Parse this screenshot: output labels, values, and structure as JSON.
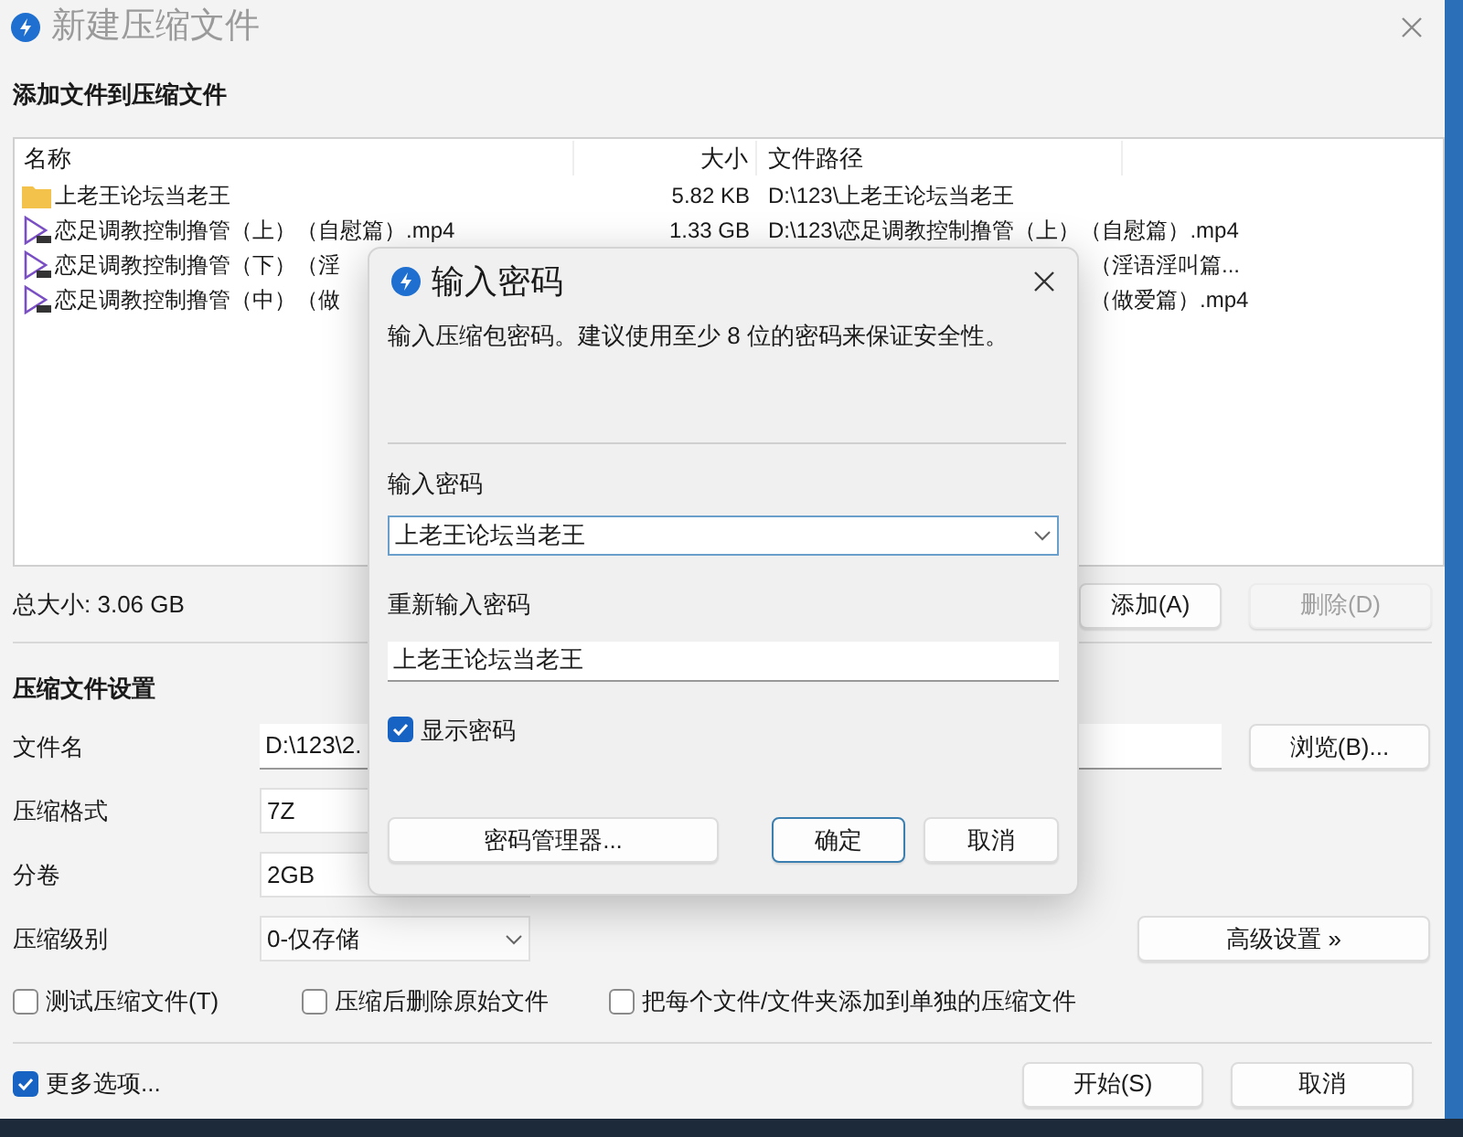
{
  "window": {
    "title": "新建压缩文件"
  },
  "files": {
    "heading": "添加文件到压缩文件",
    "columns": [
      "名称",
      "大小",
      "文件路径"
    ],
    "rows": [
      {
        "kind": "folder",
        "name": "上老王论坛当老王",
        "size": "5.82 KB",
        "path": "D:\\123\\上老王论坛当老王"
      },
      {
        "kind": "video",
        "name": "恋足调教控制撸管（上）（自慰篇）.mp4",
        "size": "1.33 GB",
        "path": "D:\\123\\恋足调教控制撸管（上）（自慰篇）.mp4"
      },
      {
        "kind": "video",
        "name": "恋足调教控制撸管（下）（淫",
        "path_tail": "（淫语淫叫篇..."
      },
      {
        "kind": "video",
        "name": "恋足调教控制撸管（中）（做",
        "path_tail": "（做爱篇）.mp4"
      }
    ],
    "total_size": "总大小: 3.06 GB",
    "buttons": [
      {
        "label": "添加(A)",
        "disabled": false
      },
      {
        "label": "删除(D)",
        "disabled": true
      }
    ]
  },
  "settings": {
    "heading": "压缩文件设置",
    "filename": {
      "label": "文件名",
      "value": "D:\\123\\2.",
      "button": "浏览(B)..."
    },
    "format": {
      "label": "压缩格式",
      "value": "7Z"
    },
    "split": {
      "label": "分卷",
      "value": "2GB"
    },
    "level": {
      "label": "压缩级别",
      "value": "0-仅存储",
      "button": "高级设置 »"
    },
    "options": [
      {
        "label": "测试压缩文件(T)",
        "checked": false
      },
      {
        "label": "压缩后删除原始文件",
        "checked": false
      },
      {
        "label": "把每个文件/文件夹添加到单独的压缩文件",
        "checked": false
      }
    ]
  },
  "footer": {
    "more_options": {
      "label": "更多选项...",
      "checked": true
    },
    "buttons": [
      "开始(S)",
      "取消"
    ]
  },
  "dialog": {
    "title": "输入密码",
    "description": "输入压缩包密码。建议使用至少 8 位的密码来保证安全性。",
    "password": {
      "label": "输入密码",
      "value": "上老王论坛当老王"
    },
    "confirm": {
      "label": "重新输入密码",
      "value": "上老王论坛当老王"
    },
    "show_password": {
      "label": "显示密码",
      "checked": true
    },
    "buttons": [
      {
        "label": "密码管理器...",
        "default": false
      },
      {
        "label": "确定",
        "default": true
      },
      {
        "label": "取消",
        "default": false
      }
    ]
  }
}
